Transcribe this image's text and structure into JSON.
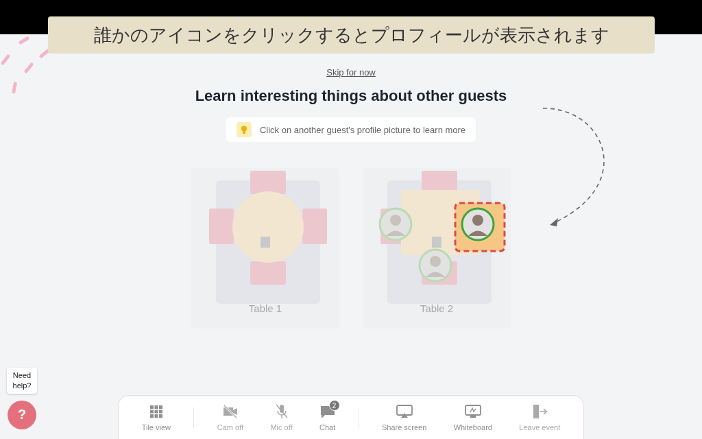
{
  "caption": "誰かのアイコンをクリックするとプロフィールが表示されます",
  "skip_link": "Skip for now",
  "heading": "Learn interesting things about other guests",
  "tip": "Click on another guest's profile picture to learn more",
  "tables": [
    {
      "label": "Table 1"
    },
    {
      "label": "Table 2",
      "guests": [
        {
          "selected": false
        },
        {
          "selected": true
        },
        {
          "selected": false
        }
      ]
    }
  ],
  "toolbar": [
    {
      "kind": "button",
      "label": "Tile view",
      "disabled": false
    },
    {
      "kind": "divider"
    },
    {
      "kind": "button",
      "label": "Cam off",
      "disabled": true
    },
    {
      "kind": "button",
      "label": "Mic off",
      "disabled": true
    },
    {
      "kind": "button",
      "label": "Chat",
      "badge": "2",
      "disabled": false
    },
    {
      "kind": "divider"
    },
    {
      "kind": "button",
      "label": "Share screen",
      "disabled": false
    },
    {
      "kind": "button",
      "label": "Whiteboard",
      "disabled": false
    },
    {
      "kind": "button",
      "label": "Leave event",
      "disabled": true
    }
  ],
  "help": {
    "bubble": "Need help?",
    "icon": "?"
  }
}
